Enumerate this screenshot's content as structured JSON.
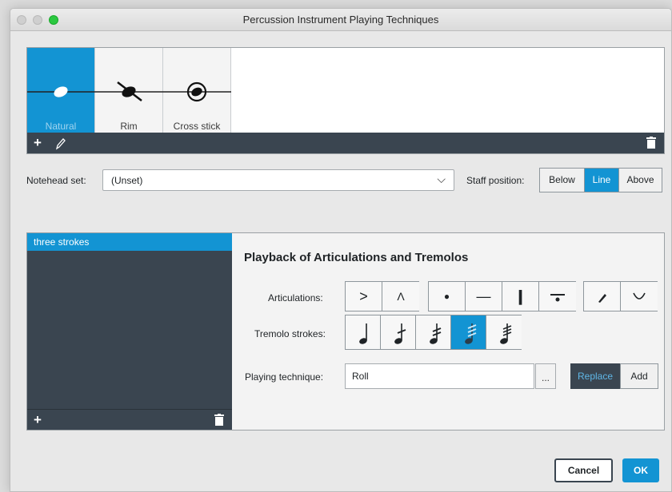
{
  "window": {
    "title": "Percussion Instrument Playing Techniques"
  },
  "techniques": {
    "tiles": [
      {
        "label": "Natural",
        "selected": true
      },
      {
        "label": "Rim",
        "selected": false
      },
      {
        "label": "Cross stick",
        "selected": false
      }
    ]
  },
  "notehead": {
    "label": "Notehead set:",
    "value": "(Unset)"
  },
  "staff_position": {
    "label": "Staff position:",
    "options": [
      {
        "label": "Below",
        "selected": false
      },
      {
        "label": "Line",
        "selected": true
      },
      {
        "label": "Above",
        "selected": false
      }
    ]
  },
  "list": {
    "items": [
      {
        "label": "three strokes",
        "selected": true
      }
    ]
  },
  "panel": {
    "heading": "Playback of Articulations and Tremolos",
    "articulations_label": "Articulations:",
    "articulation_icons": [
      "accent-icon",
      "marcato-icon",
      "staccato-icon",
      "tenuto-icon",
      "staccatissimo-icon",
      "tenuto-staccato-icon",
      "stress-icon",
      "unstress-icon"
    ],
    "tremolo_label": "Tremolo strokes:",
    "tremolo_options": [
      {
        "strokes": 0,
        "selected": false
      },
      {
        "strokes": 1,
        "selected": false
      },
      {
        "strokes": 2,
        "selected": false
      },
      {
        "strokes": 3,
        "selected": true
      },
      {
        "strokes": 4,
        "selected": false
      }
    ],
    "playing_technique_label": "Playing technique:",
    "playing_technique_value": "Roll",
    "browse_label": "...",
    "replace_label": "Replace",
    "add_label": "Add"
  },
  "footer": {
    "cancel_label": "Cancel",
    "ok_label": "OK"
  },
  "colors": {
    "accent": "#1394d3",
    "dark": "#3a4550"
  }
}
